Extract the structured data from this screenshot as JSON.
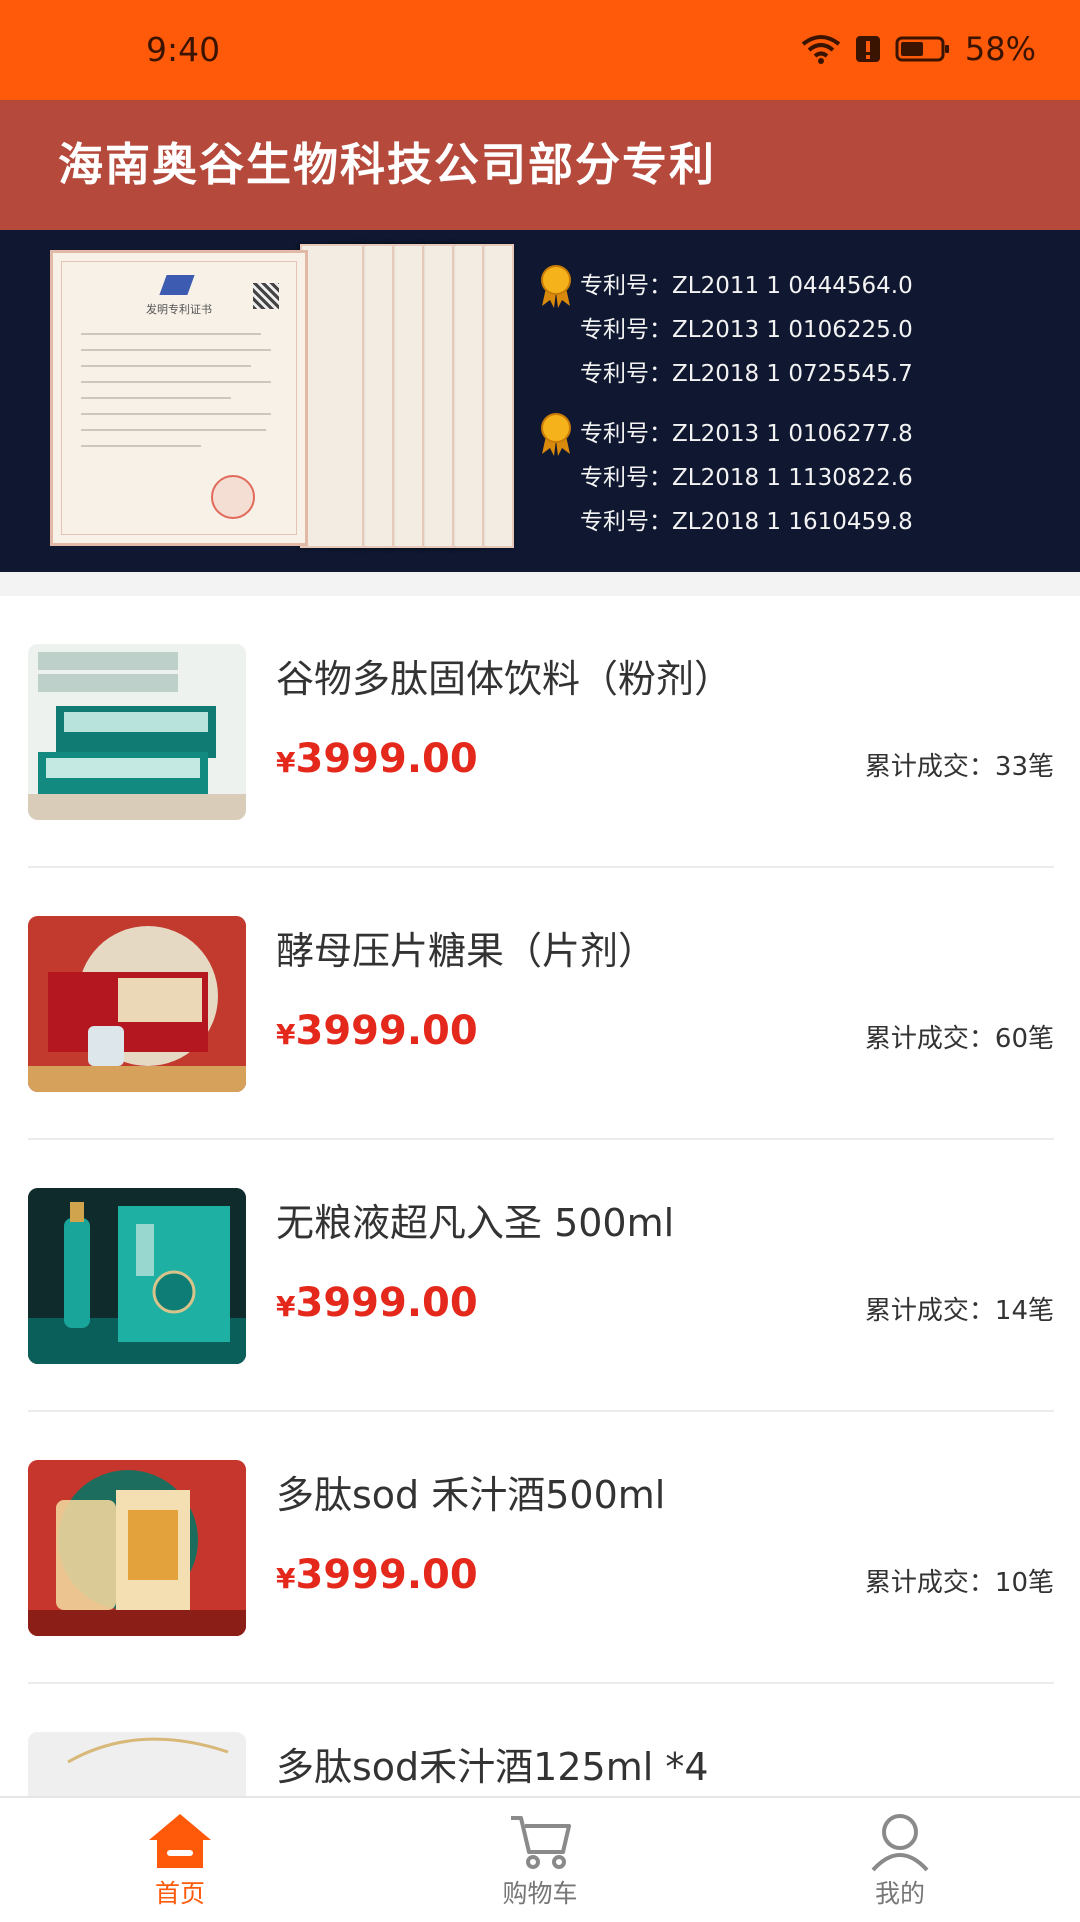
{
  "status_bar": {
    "time": "9:40",
    "battery": "58%"
  },
  "banner": {
    "title": "海南奥谷生物科技公司部分专利",
    "certificate_title": "发明专利证书",
    "patents": [
      "专利号：ZL2011 1 0444564.0",
      "专利号：ZL2013 1 0106225.0",
      "专利号：ZL2018 1 0725545.7",
      "专利号：ZL2013 1 0106277.8",
      "专利号：ZL2018 1 1130822.6",
      "专利号：ZL2018 1 1610459.8"
    ]
  },
  "products": [
    {
      "name": "谷物多肽固体饮料（粉剂）",
      "price_symbol": "¥",
      "price": "3999.00",
      "sales": "累计成交：33笔"
    },
    {
      "name": "酵母压片糖果（片剂）",
      "price_symbol": "¥",
      "price": "3999.00",
      "sales": "累计成交：60笔"
    },
    {
      "name": "无粮液超凡入圣 500ml",
      "price_symbol": "¥",
      "price": "3999.00",
      "sales": "累计成交：14笔"
    },
    {
      "name": "多肽sod 禾汁酒500ml",
      "price_symbol": "¥",
      "price": "3999.00",
      "sales": "累计成交：10笔"
    },
    {
      "name": "多肽sod禾汁酒125ml *4",
      "price_symbol": "",
      "price": "",
      "sales": ""
    }
  ],
  "tabbar": {
    "items": [
      {
        "label": "首页",
        "icon": "home-icon",
        "active": true
      },
      {
        "label": "购物车",
        "icon": "cart-icon",
        "active": false
      },
      {
        "label": "我的",
        "icon": "user-icon",
        "active": false
      }
    ]
  },
  "colors": {
    "accent": "#ff5a0a",
    "price": "#e5281c",
    "banner_title_bg": "#b5493b",
    "banner_bg": "#0f1830"
  }
}
